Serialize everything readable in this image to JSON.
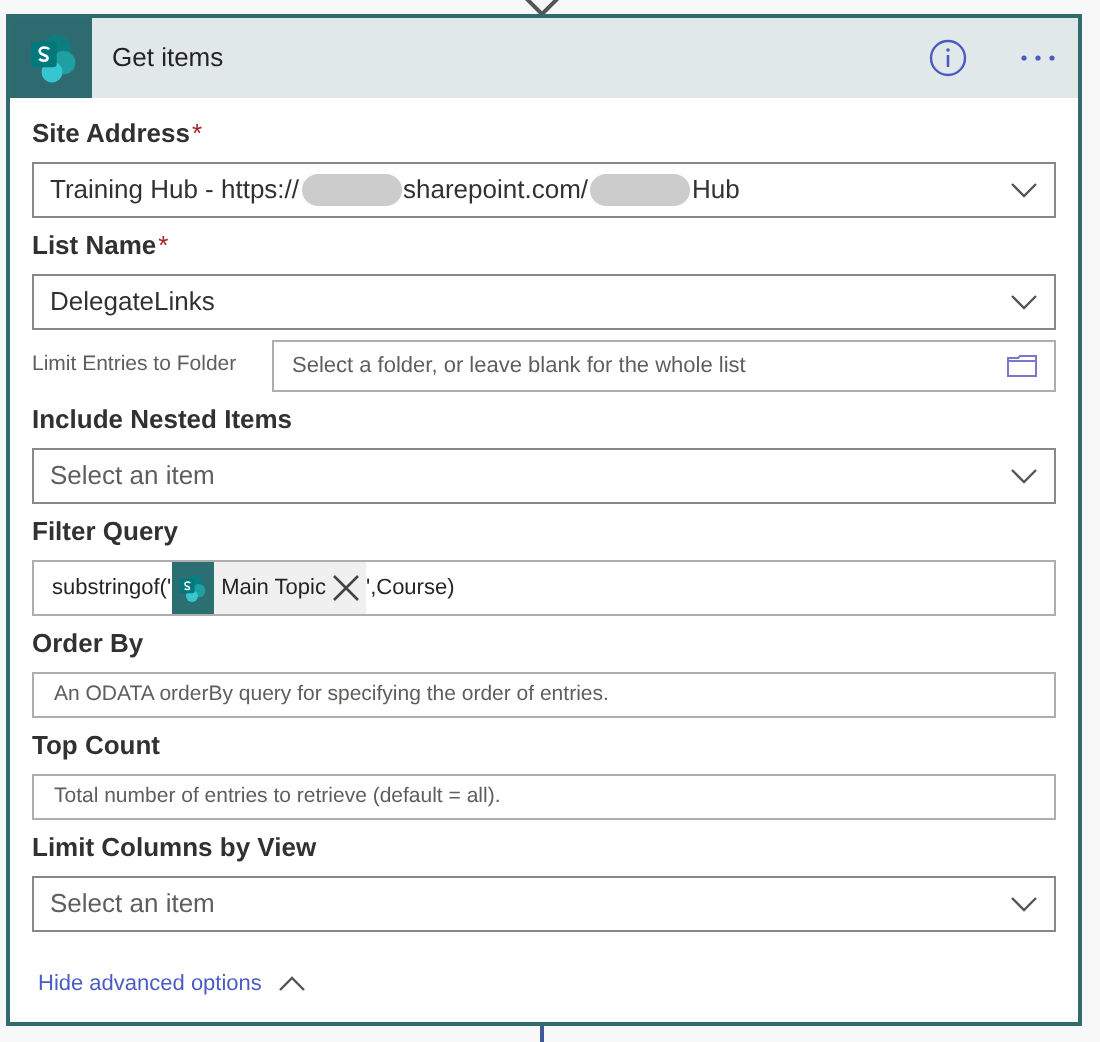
{
  "card": {
    "title": "Get items"
  },
  "fields": [
    {
      "kind": "dropdown",
      "label": "Site Address",
      "required_mark": "*",
      "value_parts": [
        "Training Hub - https://",
        "sharepoint.com/",
        "Hub"
      ]
    },
    {
      "kind": "dropdown",
      "label": "List Name",
      "required_mark": "*",
      "value_parts": [
        "DelegateLinks"
      ]
    },
    {
      "kind": "folder",
      "label": "Limit Entries to Folder",
      "placeholder": "Select a folder, or leave blank for the whole list"
    },
    {
      "kind": "dropdown",
      "label": "Include Nested Items",
      "placeholder": "Select an item"
    },
    {
      "kind": "expression",
      "label": "Filter Query",
      "parts": [
        {
          "kind": "text",
          "text": "substringof('"
        },
        {
          "kind": "token",
          "text": "Main Topic"
        },
        {
          "kind": "text",
          "text": "',Course)"
        }
      ]
    },
    {
      "kind": "text",
      "label": "Order By",
      "placeholder": "An ODATA orderBy query for specifying the order of entries."
    },
    {
      "kind": "text",
      "label": "Top Count",
      "placeholder": "Total number of entries to retrieve (default = all)."
    },
    {
      "kind": "dropdown",
      "label": "Limit Columns by View",
      "placeholder": "Select an item"
    }
  ],
  "advanced_link": "Hide advanced options"
}
